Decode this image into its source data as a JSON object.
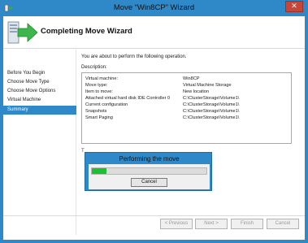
{
  "window": {
    "title": "Move “Win8CP” Wizard",
    "close_glyph": "✕"
  },
  "header": {
    "title": "Completing Move Wizard"
  },
  "sidebar": {
    "items": [
      {
        "label": "Before You Begin",
        "active": false
      },
      {
        "label": "Choose Move Type",
        "active": false
      },
      {
        "label": "Choose Move Options",
        "active": false
      },
      {
        "label": "Virtual Machine",
        "active": false
      },
      {
        "label": "Summary",
        "active": true
      }
    ]
  },
  "main": {
    "intro": "You are about to perform the following operation.",
    "description_label": "Description:",
    "summary_rows": [
      {
        "key": "Virtual machine:",
        "value": "Win8CP"
      },
      {
        "key": "Move type:",
        "value": "Virtual Machine Storage"
      },
      {
        "key": "Item to move:",
        "value": "New location"
      },
      {
        "key": "Attached virtual hard disk  IDE Controller 0",
        "value": "C:\\ClusterStorage\\Volume1\\"
      },
      {
        "key": "Current configuration",
        "value": "C:\\ClusterStorage\\Volume1\\"
      },
      {
        "key": "Snapshots",
        "value": "C:\\ClusterStorage\\Volume1\\"
      },
      {
        "key": "Smart Paging",
        "value": "C:\\ClusterStorage\\Volume1\\"
      }
    ],
    "stray_text": "T"
  },
  "progress_dialog": {
    "title": "Performing the move",
    "progress_fraction": 0.13,
    "cancel_label": "Cancel"
  },
  "footer": {
    "previous_label": "< Previous",
    "next_label": "Next >",
    "finish_label": "Finish",
    "cancel_label": "Cancel"
  },
  "colors": {
    "accent": "#2f89c8",
    "progress": "#19c22e",
    "close": "#c7463a"
  },
  "icons": [
    "hyperv-app-icon",
    "wizard-header-icon",
    "close-icon"
  ]
}
